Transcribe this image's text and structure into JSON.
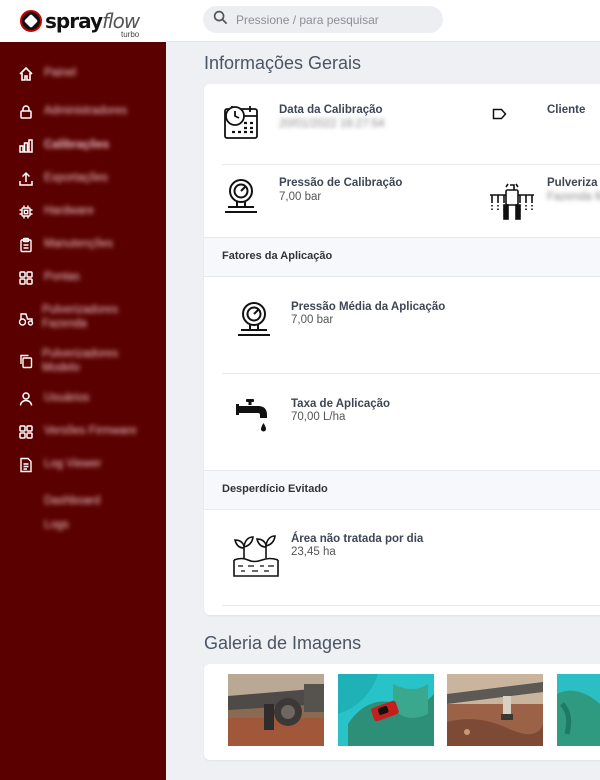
{
  "brand": {
    "name_main": "spray",
    "name_accent": "flow",
    "subtitle": "turbo"
  },
  "search": {
    "placeholder": "Pressione / para pesquisar",
    "icon": "search-icon"
  },
  "sidebar": {
    "items": [
      {
        "label": "Painel",
        "icon": "home-icon"
      },
      {
        "label": "Administradores",
        "icon": "lock-icon"
      },
      {
        "label": "Calibrações",
        "icon": "bar-chart-icon",
        "active": true
      },
      {
        "label": "Exportações",
        "icon": "upload-icon"
      },
      {
        "label": "Hardware",
        "icon": "chip-icon"
      },
      {
        "label": "Manutenções",
        "icon": "clipboard-icon"
      },
      {
        "label": "Pontas",
        "icon": "grid-icon"
      },
      {
        "label": "Pulverizadores Fazenda",
        "icon": "tractor-icon"
      },
      {
        "label": "Pulverizadores Modelo",
        "icon": "copy-icon"
      },
      {
        "label": "Usuários",
        "icon": "user-icon"
      },
      {
        "label": "Versões Firmware",
        "icon": "grid-icon"
      },
      {
        "label": "Log Viewer",
        "icon": "document-icon"
      },
      {
        "label": "Dashboard",
        "icon": ""
      },
      {
        "label": "Logs",
        "icon": ""
      }
    ]
  },
  "general_info": {
    "title": "Informações Gerais",
    "calibration_date": {
      "label": "Data da Calibração",
      "value": "20/01/2022 16:27:54",
      "icon": "calendar-clock-icon"
    },
    "client": {
      "label": "Cliente",
      "icon": "tag-icon"
    },
    "calibration_pressure": {
      "label": "Pressão de Calibração",
      "value": "7,00 bar",
      "icon": "pressure-gauge-icon"
    },
    "sprayer": {
      "label": "Pulveriza",
      "value": "Fazenda M",
      "icon": "sprayer-icon"
    }
  },
  "application_factors": {
    "title": "Fatores da Aplicação",
    "avg_pressure": {
      "label": "Pressão Média da Aplicação",
      "value": "7,00 bar",
      "icon": "pressure-gauge-icon"
    },
    "rate": {
      "label": "Taxa de Aplicação",
      "value": "70,00 L/ha",
      "icon": "faucet-icon"
    }
  },
  "waste_avoided": {
    "title": "Desperdício Evitado",
    "untreated_area": {
      "label": "Área não tratada por dia",
      "value": "23,45 ha",
      "icon": "sprout-icon"
    }
  },
  "gallery": {
    "title": "Galeria de Imagens",
    "image_count": 4
  },
  "colors": {
    "sidebar": "#5a0000",
    "background": "#eef0f3",
    "card": "#ffffff",
    "band": "#f6f8fc"
  }
}
